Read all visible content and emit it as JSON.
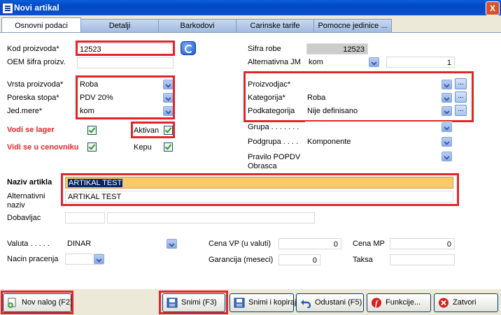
{
  "window": {
    "title": "Novi artikal",
    "close": "X"
  },
  "tabs": [
    "Osnovni podaci",
    "Detalji",
    "Barkodovi",
    "Carinske tarife",
    "Pomocne jedinice ..."
  ],
  "left": {
    "kod_label": "Kod proizvoda*",
    "kod_value": "12523",
    "oem_label": "OEM šifra proizv.",
    "vrsta_label": "Vrsta proizvoda*",
    "vrsta_value": "Roba",
    "poreska_label": "Poreska stopa*",
    "poreska_value": "PDV 20%",
    "jed_label": "Jed.mere*",
    "jed_value": "kom",
    "vodi_lager_label": "Vodi se lager",
    "vodi_cenovnik_label": "Vidi se u cenovniku",
    "aktivan_label": "Aktivan",
    "kepu_label": "Kepu"
  },
  "right": {
    "sifra_label": "Sifra robe",
    "sifra_value": "12523",
    "altjm_label": "Alternativna JM",
    "altjm_value": "kom",
    "altjm_qty": "1",
    "proizvodjac_label": "Proizvodjac*",
    "kategorija_label": "Kategorija*",
    "kategorija_value": "Roba",
    "podkategorija_label": "Podkategorija",
    "podkategorija_value": "Nije definisano",
    "grupa_label": "Grupa . . . . . . .",
    "podgrupa_label": "Podgrupa . . . .",
    "podgrupa_value": "Komponente",
    "pravilo_label_1": "Pravilo POPDV",
    "pravilo_label_2": "Obrasca",
    "more_label": "..."
  },
  "naziv": {
    "naziv_label": "Naziv artikla",
    "naziv_value": "ARTIKAL TEST",
    "alt_label_1": "Alternativni",
    "alt_label_2": "naziv",
    "alt_value": "ARTIKAL TEST",
    "dobavljac_label": "Dobavljac"
  },
  "bottom": {
    "valuta_label": "Valuta . . . . .",
    "valuta_value": "DINAR",
    "nacin_label": "Nacin pracenja",
    "cenavp_label": "Cena VP (u valuti)",
    "cenavp_value": "0",
    "cenamp_label": "Cena MP",
    "cenamp_value": "0",
    "garancija_label": "Garancija (meseci)",
    "garancija_value": "0",
    "taksa_label": "Taksa"
  },
  "buttons": {
    "novi": "Nov nalog (F2)",
    "snimi": "Snimi (F3)",
    "snimi_kopiraj": "Snimi i kopiraj",
    "odustani": "Odustani (F5)",
    "funkcije": "Funkcije...",
    "zatvori": "Zatvori"
  },
  "colors": {
    "title_bar": "#0347c4",
    "highlight": "#e3242b",
    "naziv_field": "#fbc96a"
  }
}
